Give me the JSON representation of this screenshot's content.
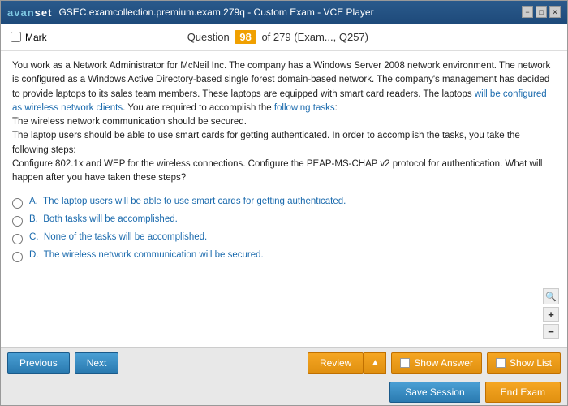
{
  "titleBar": {
    "logo": "avanset",
    "title": "GSEC.examcollection.premium.exam.279q - Custom Exam - VCE Player",
    "controls": {
      "minimize": "−",
      "maximize": "□",
      "close": "✕"
    }
  },
  "questionHeader": {
    "markLabel": "Mark",
    "questionLabel": "Question",
    "questionNumber": "98",
    "totalQuestions": "of 279",
    "examInfo": "(Exam..., Q257)"
  },
  "questionText": "You work as a Network Administrator for McNeil Inc. The company has a Windows Server 2008 network environment. The network is configured as a Windows Active Directory-based single forest domain-based network. The company's management has decided to provide laptops to its sales team members. These laptops are equipped with smart card readers. The laptops will be configured as wireless network clients. You are required to accomplish the following tasks:\nThe wireless network communication should be secured.\nThe laptop users should be able to use smart cards for getting authenticated. In order to accomplish the tasks, you take the following steps:\nConfigure 802.1x and WEP for the wireless connections. Configure the PEAP-MS-CHAP v2 protocol for authentication. What will happen after you have taken these steps?",
  "answers": [
    {
      "id": "A",
      "text": "A.  The laptop users will be able to use smart cards for getting authenticated."
    },
    {
      "id": "B",
      "text": "B.  Both tasks will be accomplished."
    },
    {
      "id": "C",
      "text": "C.  None of the tasks will be accomplished."
    },
    {
      "id": "D",
      "text": "D.  The wireless network communication will be secured."
    }
  ],
  "toolbar1": {
    "previousLabel": "Previous",
    "nextLabel": "Next",
    "reviewLabel": "Review",
    "reviewArrow": "▲",
    "showAnswerLabel": "Show Answer",
    "showListLabel": "Show List"
  },
  "toolbar2": {
    "saveSessionLabel": "Save Session",
    "endExamLabel": "End Exam"
  },
  "zoom": {
    "searchIcon": "🔍",
    "plusIcon": "+",
    "minusIcon": "−"
  }
}
